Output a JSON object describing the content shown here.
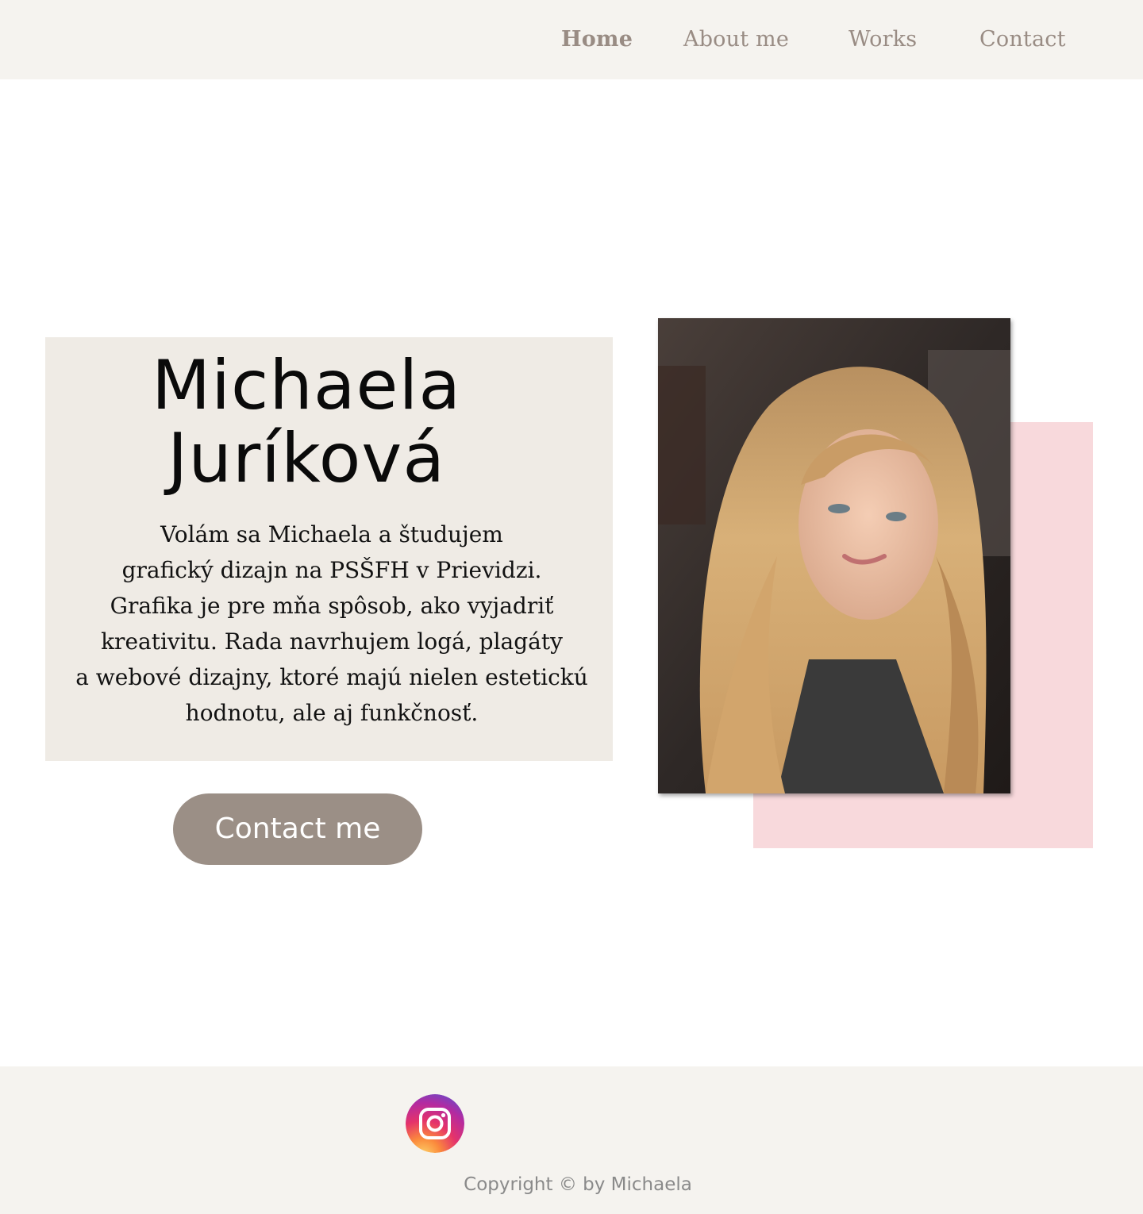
{
  "nav": {
    "items": [
      {
        "label": "Home",
        "active": true
      },
      {
        "label": "About me",
        "active": false
      },
      {
        "label": "Works",
        "active": false
      },
      {
        "label": "Contact",
        "active": false
      }
    ]
  },
  "hero": {
    "name_line1": "Michaela",
    "name_line2": "Juríková",
    "bio_lines": [
      "Volám sa Michaela a študujem",
      "grafický dizajn na PSŠFH v Prievidzi.",
      "Grafika je pre mňa spôsob, ako vyjadriť",
      "kreativitu. Rada navrhujem logá, plagáty",
      "a webové dizajny, ktoré majú nielen estetickú",
      "hodnotu, ale aj funkčnosť."
    ],
    "contact_button_label": "Contact me"
  },
  "footer": {
    "instagram_icon": "instagram-icon",
    "copyright": "Copyright © by Michaela"
  },
  "colors": {
    "header_bg": "#f5f3ef",
    "nav_text": "#998c84",
    "card_bg": "#efebe5",
    "button_bg": "#9b8f86",
    "accent_pink": "#f8d9dc"
  }
}
